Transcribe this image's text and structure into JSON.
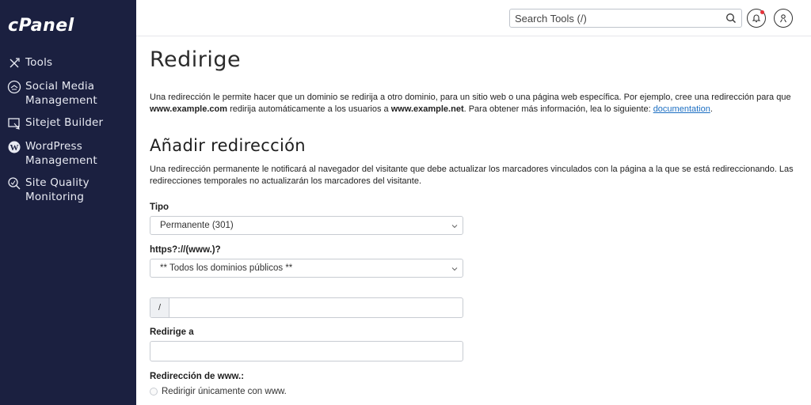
{
  "sidebar": {
    "logo": "cPanel",
    "items": [
      {
        "label": "Tools",
        "icon": "tools-icon"
      },
      {
        "label": "Social Media Management",
        "icon": "social-media-icon"
      },
      {
        "label": "Sitejet Builder",
        "icon": "sitejet-icon"
      },
      {
        "label": "WordPress Management",
        "icon": "wordpress-icon"
      },
      {
        "label": "Site Quality Monitoring",
        "icon": "site-quality-icon"
      }
    ]
  },
  "topbar": {
    "search_placeholder": "Search Tools (/)",
    "notification_dot_color": "#e5333a"
  },
  "main": {
    "title": "Redirige",
    "intro_part1": "Una redirección le permite hacer que un dominio se redirija a otro dominio, para un sitio web o una página web específica. Por ejemplo, cree una redirección para que ",
    "intro_bold1": "www.example.com",
    "intro_part2": " redirija automáticamente a los usuarios a ",
    "intro_bold2": "www.example.net",
    "intro_part3": ". Para obtener más información, lea lo siguiente: ",
    "intro_link": "documentation",
    "intro_end": ".",
    "section_title": "Añadir redirección",
    "section_desc": "Una redirección permanente le notificará al navegador del visitante que debe actualizar los marcadores vinculados con la página a la que se está redireccionando. Las redirecciones temporales no actualizarán los marcadores del visitante.",
    "type_label": "Tipo",
    "type_value": "Permanente (301)",
    "domain_label": "https?://(www.)?",
    "domain_value": "** Todos los dominios públicos **",
    "path_prefix": "/",
    "path_value": "",
    "redirect_to_label": "Redirige a",
    "redirect_to_value": "",
    "www_label": "Redirección de www.:",
    "www_option1": "Redirigir únicamente con www."
  },
  "colors": {
    "sidebar_bg": "#1b2040",
    "link": "#1b6ec2"
  }
}
